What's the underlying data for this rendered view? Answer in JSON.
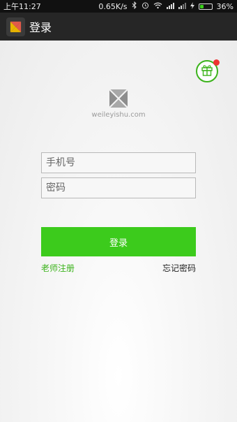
{
  "status_bar": {
    "time": "上午11:27",
    "network_speed": "0.65K/s",
    "battery_percent": "36%",
    "battery_level": 0.36,
    "icons": [
      "bluetooth-icon",
      "alarm-icon",
      "wifi-icon",
      "signal-icon",
      "signal-icon",
      "charging-icon",
      "battery-icon"
    ]
  },
  "title_bar": {
    "title": "登录",
    "app_icon": "app-logo-icon"
  },
  "header": {
    "gift_icon": "gift-icon",
    "notification_dot_color": "#ee3333"
  },
  "logo": {
    "text": "weileyishu.com"
  },
  "form": {
    "phone_placeholder": "手机号",
    "password_placeholder": "密码",
    "login_label": "登录",
    "register_label": "老师注册",
    "forgot_label": "忘记密码"
  },
  "colors": {
    "accent": "#3ccb1c",
    "title_bar": "#262626",
    "status_bar": "#111111"
  }
}
